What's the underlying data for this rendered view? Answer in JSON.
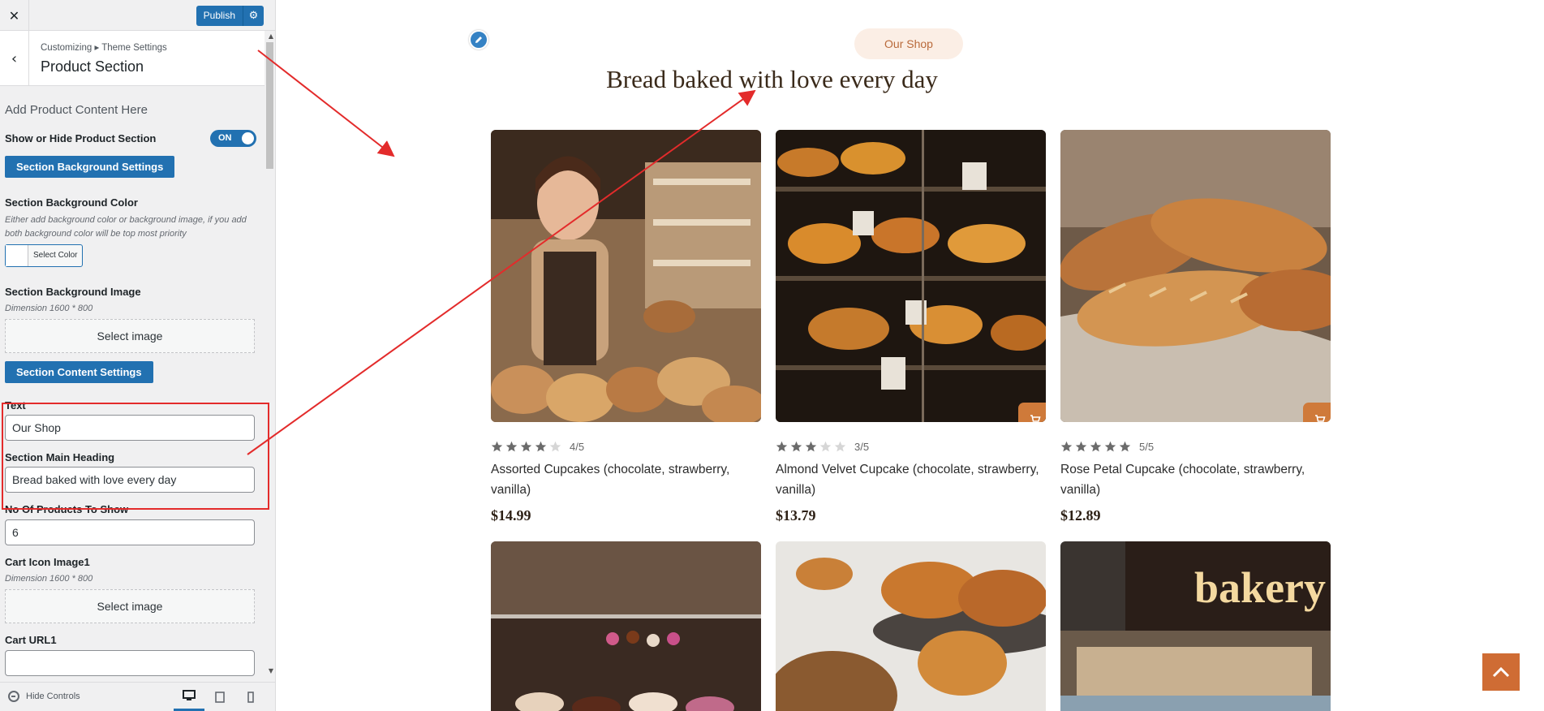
{
  "customizer": {
    "close_icon": "close-icon",
    "publish_label": "Publish",
    "breadcrumb": "Customizing ▸ Theme Settings",
    "section_title": "Product Section",
    "lead_text": "Add Product Content Here",
    "show_hide_label": "Show or Hide Product Section",
    "toggle_state": "ON",
    "bg_settings_button": "Section Background Settings",
    "bg_color_label": "Section Background Color",
    "bg_color_desc": "Either add background color or background image, if you add both background color will be top most priority",
    "select_color_label": "Select Color",
    "bg_image_label": "Section Background Image",
    "bg_image_desc": "Dimension 1600 * 800",
    "select_image_label": "Select image",
    "content_settings_button": "Section Content Settings",
    "text_label": "Text",
    "text_value": "Our Shop",
    "heading_label": "Section Main Heading",
    "heading_value": "Bread baked with love every day",
    "products_count_label": "No Of Products To Show",
    "products_count_value": "6",
    "cart_icon_label": "Cart Icon Image1",
    "cart_icon_desc": "Dimension 1600 * 800",
    "cart_select_image": "Select image",
    "cart_url_label": "Cart URL1",
    "hide_controls": "Hide Controls"
  },
  "preview": {
    "pill_text": "Our Shop",
    "heading": "Bread baked with love every day",
    "products": [
      {
        "rating": 4,
        "rating_text": "4/5",
        "name": "Assorted Cupcakes (chocolate, strawberry, vanilla)",
        "price": "$14.99",
        "has_cart": false
      },
      {
        "rating": 3,
        "rating_text": "3/5",
        "name": "Almond Velvet Cupcake (chocolate, strawberry, vanilla)",
        "price": "$13.79",
        "has_cart": true
      },
      {
        "rating": 5,
        "rating_text": "5/5",
        "name": "Rose Petal Cupcake (chocolate, strawberry, vanilla)",
        "price": "$12.89",
        "has_cart": true
      }
    ],
    "bakery_sign": "bakery"
  },
  "colors": {
    "accent_blue": "#2271b1",
    "brand_orange": "#cf7a3a",
    "annotation_red": "#e32b2b"
  }
}
